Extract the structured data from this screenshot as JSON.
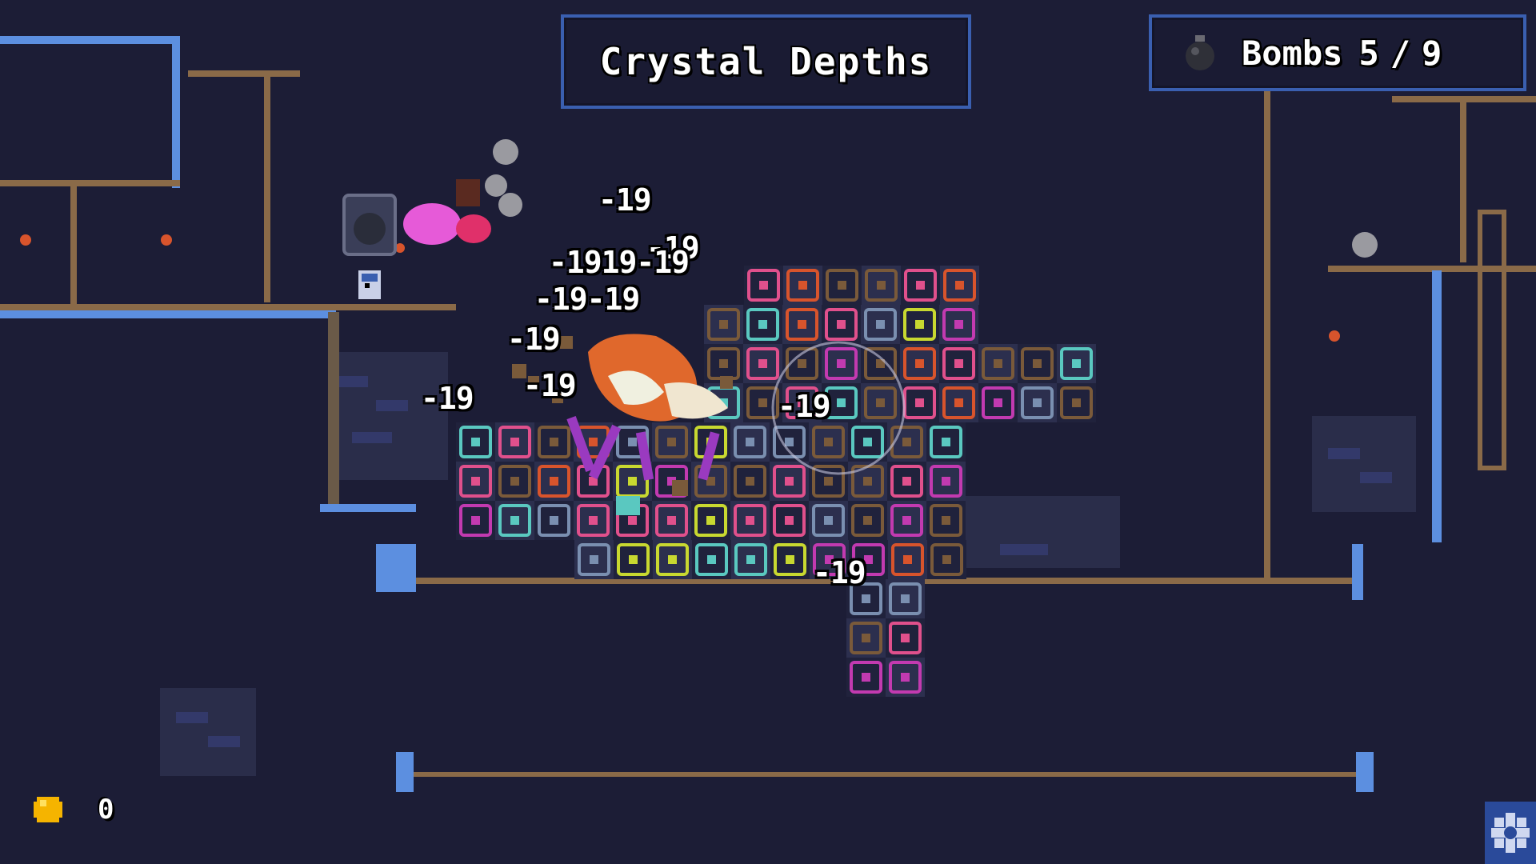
{
  "level": {
    "title": "Crystal Depths"
  },
  "bombs": {
    "label": "Bombs",
    "current": "5",
    "separator": "/",
    "max": "9",
    "icon": "bomb-icon"
  },
  "coins": {
    "count": "0",
    "icon": "coin-icon"
  },
  "settings": {
    "icon": "gear-icon"
  },
  "damage_numbers": [
    "-19",
    "-19",
    "-1919-19",
    "-19-19",
    "-19",
    "-19",
    "-19",
    "-19",
    "-19"
  ],
  "colors": {
    "background": "#1c1d36",
    "hud_border": "#3a5fb0",
    "wood": "#8a6a48",
    "frost": "#5c8fe0",
    "block_pink": "#e0508c",
    "block_magenta": "#c23ab0",
    "block_yellow": "#c8d830",
    "block_blue": "#7a8fb0",
    "block_orange": "#d8542c",
    "block_cyan": "#5ac8c0",
    "block_brown": "#7a5a3a"
  }
}
